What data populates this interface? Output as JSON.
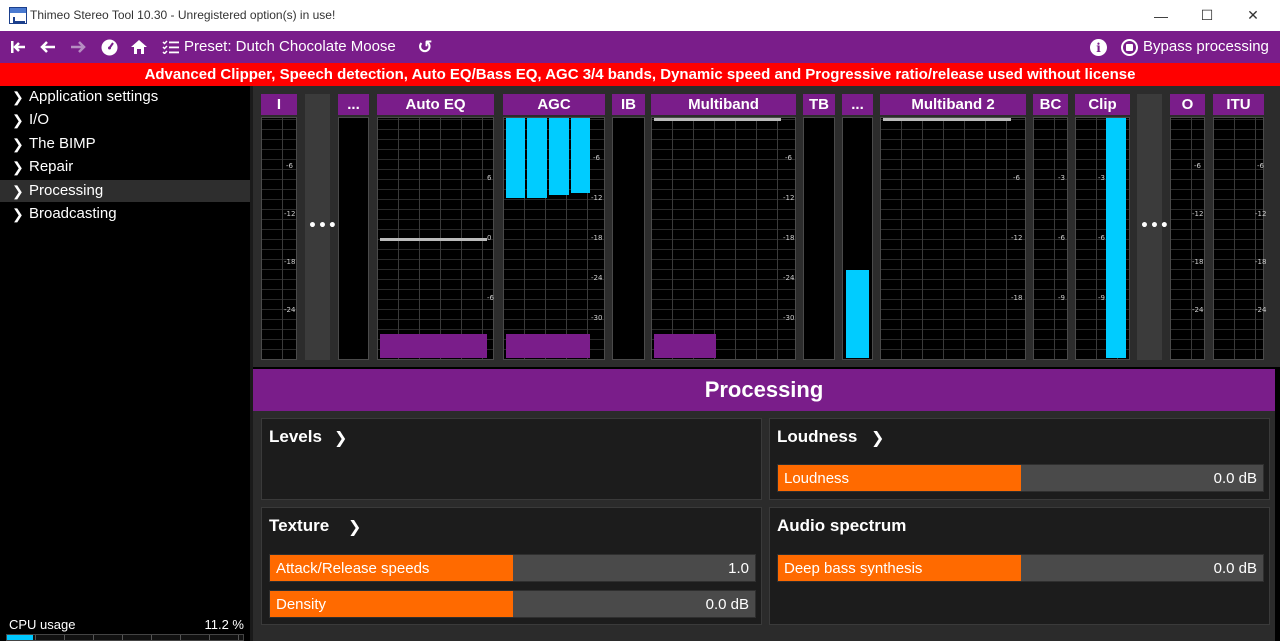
{
  "window": {
    "title": "Thimeo Stereo Tool 10.30 - Unregistered option(s) in use!",
    "minimize_glyph": "—",
    "maximize_glyph": "☐",
    "close_glyph": "✕"
  },
  "toolbar": {
    "icons": [
      "skip-back-icon",
      "back-arrow-icon",
      "forward-arrow-icon",
      "gauge-icon",
      "home-icon",
      "preset-list-icon"
    ],
    "preset_label": "Preset: Dutch Chocolate Moose",
    "reset_glyph": "↺",
    "info_glyph": "i",
    "bypass_label": "Bypass processing"
  },
  "banner": {
    "text": "Advanced Clipper, Speech detection, Auto EQ/Bass EQ, AGC 3/4 bands, Dynamic speed and Progressive ratio/release used without license"
  },
  "sidebar": {
    "chevron": "❯",
    "items": [
      {
        "label": "Application settings",
        "active": false
      },
      {
        "label": "I/O",
        "active": false
      },
      {
        "label": "The BIMP",
        "active": false
      },
      {
        "label": "Repair",
        "active": false
      },
      {
        "label": "Processing",
        "active": true
      },
      {
        "label": "Broadcasting",
        "active": false
      }
    ],
    "cpu": {
      "label": "CPU usage",
      "value": "11.2 %",
      "fraction": 0.112
    }
  },
  "meters": {
    "headers": [
      "I",
      "...",
      "Auto EQ",
      "AGC",
      "IB",
      "Multiband",
      "TB",
      "...",
      "Multiband 2",
      "BC",
      "Clip",
      "O",
      "ITU"
    ],
    "more_glyph": "•••",
    "scales": {
      "I": [
        "-6",
        "-12",
        "-18",
        "-24"
      ],
      "auto_eq": [
        "6",
        "0",
        "-6"
      ],
      "agc": [
        "-6",
        "-12",
        "-18",
        "-24",
        "-30"
      ],
      "multiband": [
        "-6",
        "-12",
        "-18",
        "-24",
        "-30"
      ],
      "multiband2": [
        "-6",
        "-12",
        "-18"
      ],
      "bc": [
        "-3",
        "-6",
        "-9"
      ],
      "clip": [
        "-3",
        "-6",
        "-9"
      ],
      "o": [
        "-6",
        "-12",
        "-18",
        "-24"
      ],
      "itu": [
        "-6",
        "-12",
        "-18",
        "-24"
      ]
    }
  },
  "processing": {
    "title": "Processing",
    "chevron": "❯",
    "cards": {
      "levels": {
        "title": "Levels"
      },
      "loudness": {
        "title": "Loudness",
        "sliders": [
          {
            "label": "Loudness",
            "value": "0.0 dB",
            "fraction": 0.5
          }
        ]
      },
      "texture": {
        "title": "Texture",
        "sliders": [
          {
            "label": "Attack/Release speeds",
            "value": "1.0",
            "fraction": 0.5
          },
          {
            "label": "Density",
            "value": "0.0 dB",
            "fraction": 0.5
          }
        ]
      },
      "audio_spectrum": {
        "title": "Audio spectrum",
        "sliders": [
          {
            "label": "Deep bass synthesis",
            "value": "0.0 dB",
            "fraction": 0.5
          }
        ]
      }
    }
  },
  "colors": {
    "accent_purple": "#7a1d8a",
    "warning_red": "#ff0000",
    "meter_blue": "#00ccff",
    "slider_orange": "#ff6a00"
  }
}
